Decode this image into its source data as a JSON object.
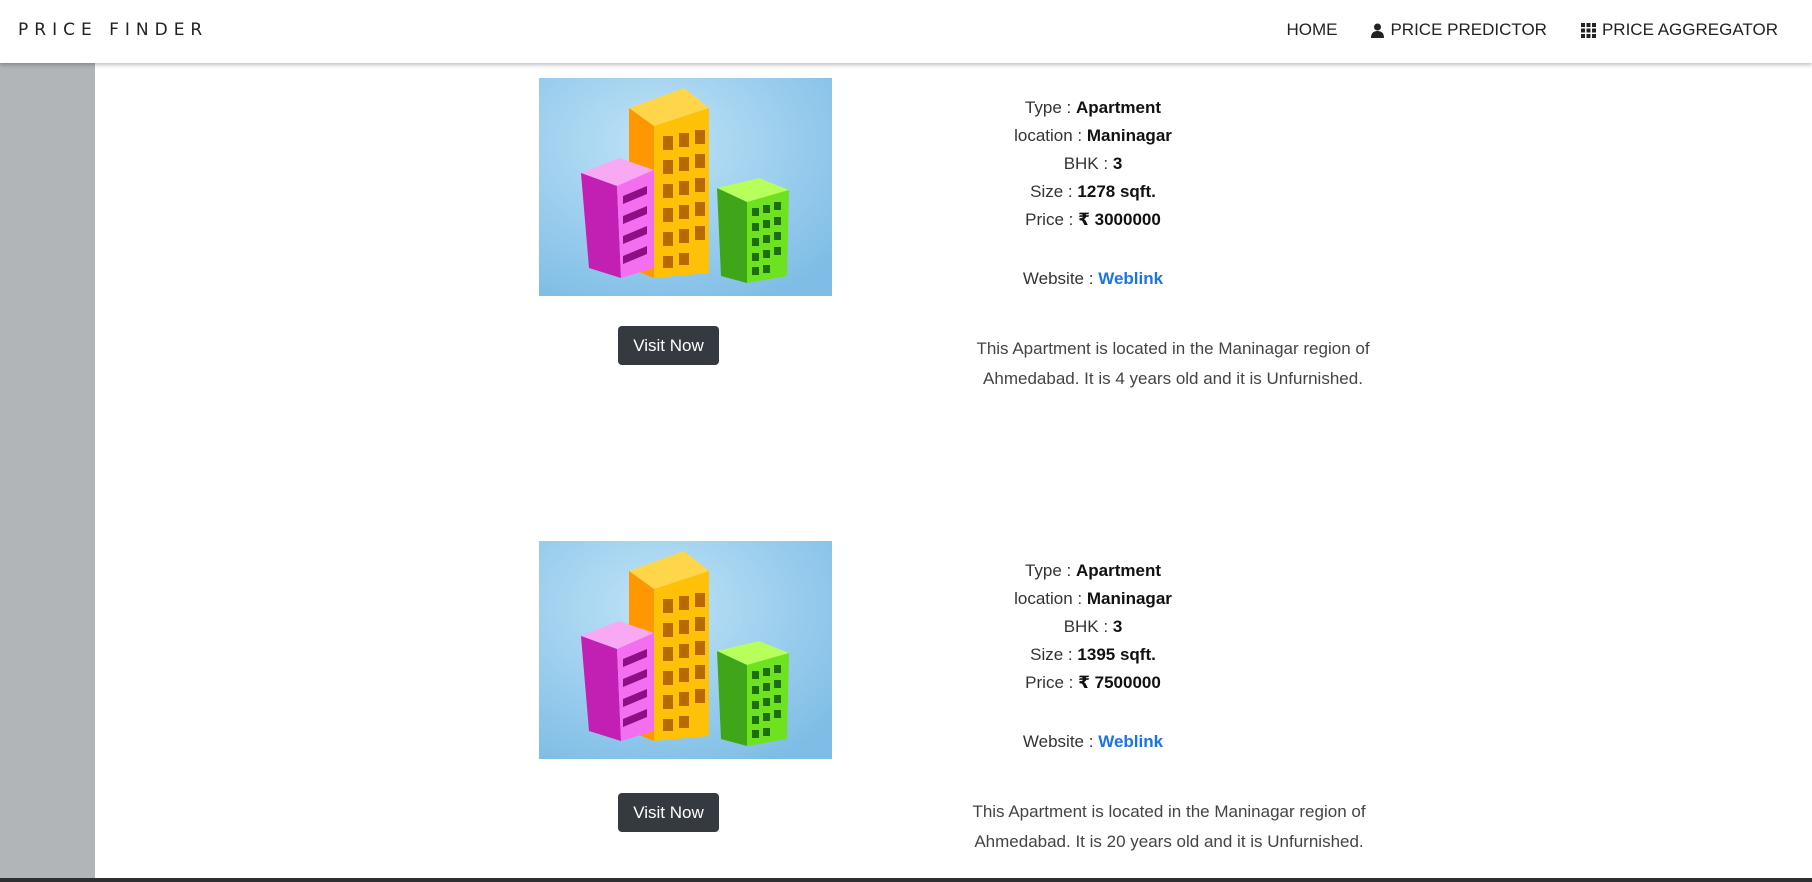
{
  "nav": {
    "brand": "PRICE FINDER",
    "items": [
      {
        "label": "HOME",
        "icon": ""
      },
      {
        "label": "PRICE PREDICTOR",
        "icon": "user-icon"
      },
      {
        "label": "PRICE AGGREGATOR",
        "icon": "grid-icon"
      }
    ]
  },
  "labels": {
    "type": "Type :",
    "location": "location :",
    "bhk": "BHK :",
    "size": "Size :",
    "price": "Price :",
    "website": "Website :",
    "visit": "Visit Now",
    "weblink": "Weblink"
  },
  "listings": [
    {
      "type": "Apartment",
      "location": "Maninagar",
      "bhk": "3",
      "size": "1278 sqft.",
      "price": "₹ 3000000",
      "description": "This Apartment is located in the Maninagar region of Ahmedabad. It is 4 years old and it is Unfurnished."
    },
    {
      "type": "Apartment",
      "location": "Maninagar",
      "bhk": "3",
      "size": "1395 sqft.",
      "price": "₹ 7500000",
      "description": "This Apartment is located in the Maninagar region of Ahmedabad. It is 20 years old and it is Unfurnished."
    }
  ],
  "colors": {
    "sidebar": "#b1b5b7",
    "button": "#343a40",
    "link": "#1a73e8"
  }
}
